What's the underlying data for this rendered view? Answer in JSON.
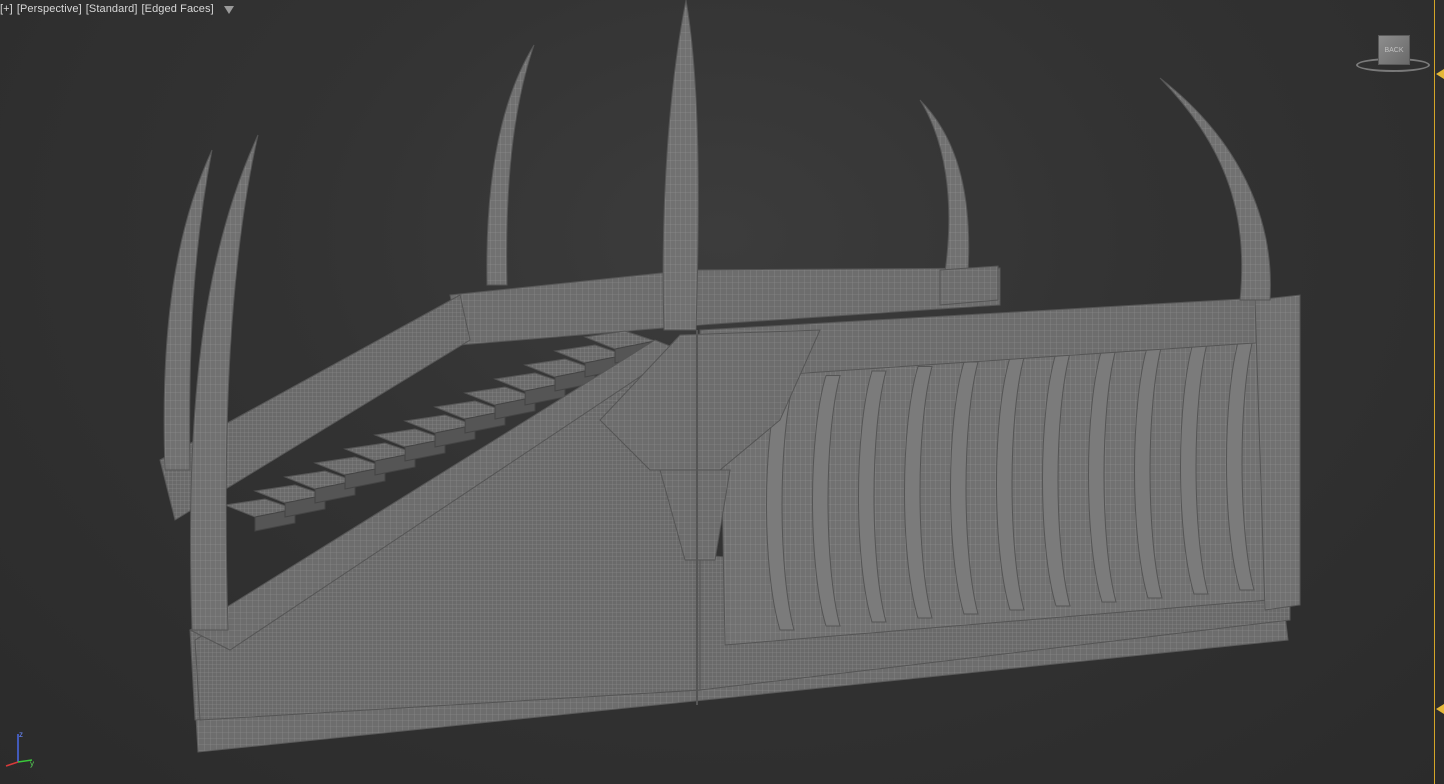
{
  "viewport": {
    "plus_label": "[+]",
    "view_label": "[Perspective]",
    "shading_label": "[Standard]",
    "display_label": "[Edged Faces]",
    "filter_icon": "filter-icon"
  },
  "viewcube": {
    "face_label": "BACK"
  },
  "axis_tripod": {
    "x": "x",
    "y": "y",
    "z": "z"
  },
  "colors": {
    "background": "#2a2a2a",
    "mesh_fill": "#6e6e6e",
    "wireframe": "#9a9a9a",
    "accent": "#e5b838",
    "axis_x": "#d83a3a",
    "axis_y": "#3ac83a",
    "axis_z": "#4a6ae8"
  }
}
